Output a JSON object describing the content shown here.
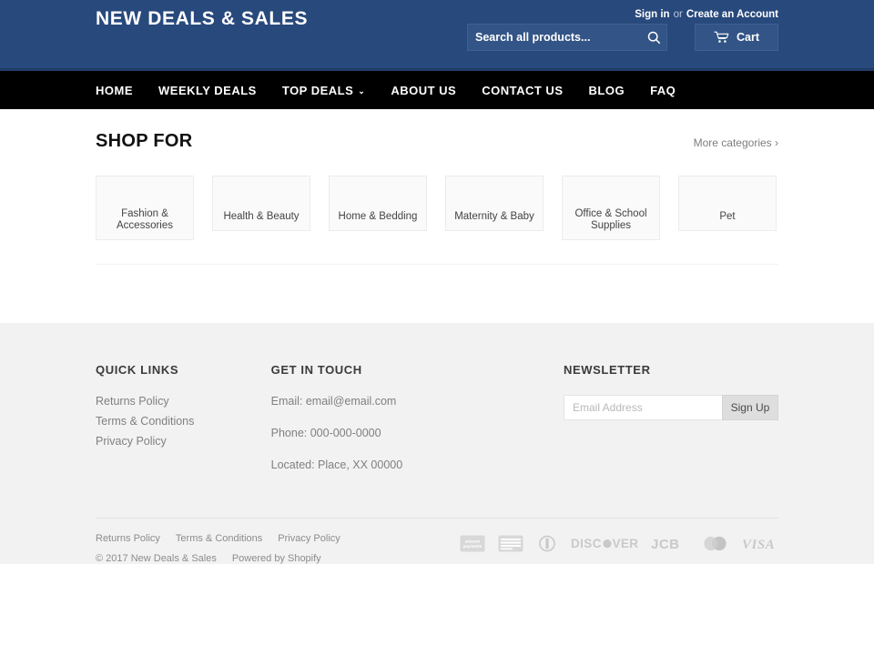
{
  "header": {
    "logo": "NEW DEALS & SALES",
    "account": {
      "sign_in": "Sign in",
      "or": "or",
      "create": "Create an Account"
    },
    "search": {
      "placeholder": "Search all products...",
      "value": "",
      "icon": "search-icon"
    },
    "cart": {
      "label": "Cart",
      "icon": "cart-icon"
    },
    "bg_color": "#28497c"
  },
  "nav": {
    "items": [
      {
        "label": "HOME",
        "has_dropdown": false
      },
      {
        "label": "WEEKLY DEALS",
        "has_dropdown": false
      },
      {
        "label": "TOP DEALS",
        "has_dropdown": true,
        "caret": "⌄"
      },
      {
        "label": "ABOUT US",
        "has_dropdown": false
      },
      {
        "label": "CONTACT US",
        "has_dropdown": false
      },
      {
        "label": "BLOG",
        "has_dropdown": false
      },
      {
        "label": "FAQ",
        "has_dropdown": false
      }
    ],
    "bg_color": "#000000"
  },
  "main": {
    "title": "SHOP FOR",
    "more_categories": "More categories ›",
    "categories": [
      {
        "label": "Fashion & Accessories"
      },
      {
        "label": "Health & Beauty"
      },
      {
        "label": "Home & Bedding"
      },
      {
        "label": "Maternity & Baby"
      },
      {
        "label": "Office & School Supplies"
      },
      {
        "label": "Pet"
      }
    ]
  },
  "footer": {
    "quick_links": {
      "title": "QUICK LINKS",
      "items": [
        "Returns Policy",
        "Terms & Conditions",
        "Privacy Policy"
      ]
    },
    "get_in_touch": {
      "title": "GET IN TOUCH",
      "email": "Email: email@email.com",
      "phone": "Phone: 000-000-0000",
      "located": "Located: Place, XX 00000"
    },
    "newsletter": {
      "title": "NEWSLETTER",
      "placeholder": "Email Address",
      "value": "",
      "button": "Sign Up"
    },
    "bottom_links": [
      "Returns Policy",
      "Terms & Conditions",
      "Privacy Policy"
    ],
    "copyright": "© 2017 New Deals & Sales",
    "powered_by": "Powered by Shopify",
    "payment_icons": [
      "amazon-payments-icon",
      "american-express-icon",
      "diners-club-icon",
      "discover-icon",
      "jcb-icon",
      "mastercard-icon",
      "visa-icon"
    ],
    "bg_color": "#f2f2f2"
  }
}
